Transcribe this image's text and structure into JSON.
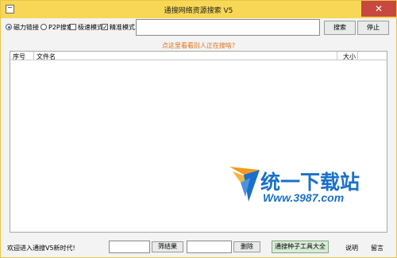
{
  "window": {
    "title": "通搜网络资源搜索 V5",
    "close_symbol": "✕"
  },
  "options": {
    "magnet_label": "磁力链接",
    "p2p_label": "P2P搜索",
    "fast_mode_label": "极速模式",
    "precise_mode_label": "精准模式",
    "magnet_selected": true,
    "p2p_selected": false,
    "fast_mode_checked": false,
    "precise_mode_checked": true,
    "check_mark": "✓"
  },
  "search": {
    "value": "",
    "search_label": "搜索",
    "stop_label": "停止"
  },
  "hint": "点这里看看别人正在搜啥?",
  "table": {
    "columns": [
      "序号",
      "文件名",
      "大小"
    ],
    "rows": []
  },
  "watermark": {
    "text": "统一下载站",
    "url": "Www.3987.com"
  },
  "footer": {
    "welcome": "欢迎进入通搜V5新时代!",
    "filter_value": "",
    "filter_label": "筛结果",
    "delete_value": "",
    "delete_label": "删除",
    "tools_label": "通搜种子工具大全",
    "help_label": "说明",
    "message_label": "留言"
  },
  "colors": {
    "titlebar": "#f7d755",
    "close": "#c7483e",
    "hint": "#e0701a",
    "watermark": "#1a70c8"
  }
}
